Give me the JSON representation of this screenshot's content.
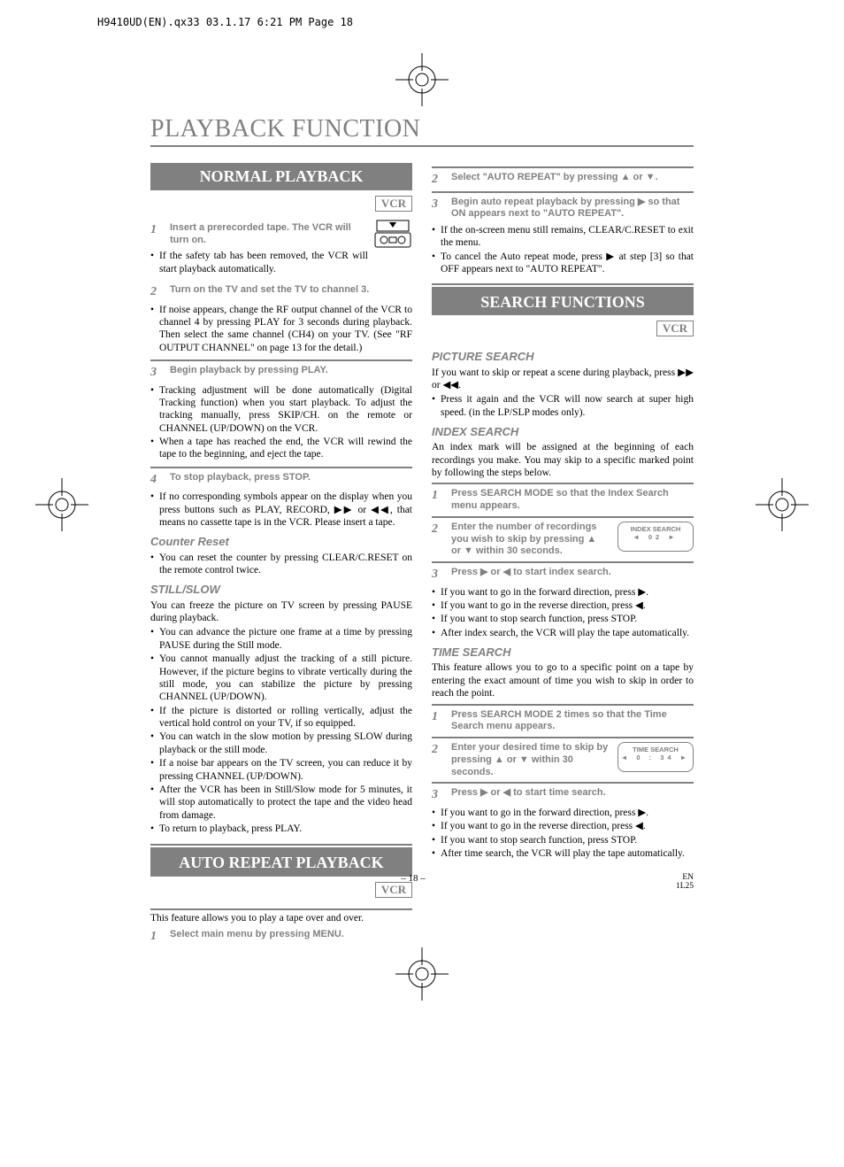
{
  "slug": "H9410UD(EN).qx33   03.1.17  6:21 PM   Page 18",
  "page_title": "PLAYBACK FUNCTION",
  "vcr_label": "VCR",
  "page_num": "– 18 –",
  "footer_en": "EN",
  "footer_code": "1L25",
  "normal": {
    "title": "NORMAL PLAYBACK",
    "step1": "Insert a prerecorded tape. The VCR will turn on.",
    "b1": "If the safety tab has been removed, the VCR will start playback automatically.",
    "step2": "Turn on the TV and set the TV to channel 3.",
    "b2": "If noise appears, change the RF output channel of the VCR to channel 4 by pressing PLAY for 3 seconds during playback.  Then select the same channel (CH4)  on  your  TV.  (See \"RF  OUTPUT CHANNEL\" on page 13 for the detail.)",
    "step3": "Begin playback by pressing PLAY.",
    "b3a": "Tracking adjustment will be done automatically (Digital Tracking function) when you start playback. To adjust the tracking manually, press SKIP/CH. on the remote or CHANNEL (UP/DOWN) on the VCR.",
    "b3b": "When a tape has reached the end, the VCR will rewind the tape to the beginning, and eject the tape.",
    "step4": "To stop playback, press STOP.",
    "b4": "If no corresponding symbols appear on the display when you press buttons such as PLAY, RECORD, ▶▶ or ◀◀, that means no cassette tape is in the VCR. Please insert a tape.",
    "counter_head": "Counter Reset",
    "counter_b": "You can reset the counter by pressing CLEAR/C.RESET on the remote control twice.",
    "still_head": "STILL/SLOW",
    "still_para": "You can freeze the picture on TV screen by pressing PAUSE during playback.",
    "still_b1": "You can advance the picture one frame at a time by pressing PAUSE during the Still mode.",
    "still_b2": "You cannot manually adjust the tracking of a still picture. However, if the picture begins to vibrate vertically during the still mode, you can stabilize the picture by pressing CHANNEL (UP/DOWN).",
    "still_b3": "If the picture is distorted or rolling vertically, adjust the vertical hold control on your TV, if so equipped.",
    "still_b4": "You can watch in the slow motion by pressing SLOW during playback or the still mode.",
    "still_b5": "If a noise bar appears on the TV screen, you can reduce it by pressing CHANNEL (UP/DOWN).",
    "still_b6": "After the VCR has been in Still/Slow mode for 5 minutes, it will stop automatically to protect the tape and the video head from damage.",
    "still_b7": "To return to playback, press PLAY."
  },
  "auto": {
    "title": "AUTO REPEAT PLAYBACK",
    "para": "This feature allows you to play a tape over and over.",
    "step1": "Select main menu by pressing MENU.",
    "step2": "Select \"AUTO REPEAT\" by pressing ▲ or ▼.",
    "step3": "Begin auto repeat playback by pressing ▶ so that ON appears next to \"AUTO REPEAT\".",
    "b1": "If    the    on-screen    menu    still    remains, CLEAR/C.RESET to exit the menu.",
    "b2": "To cancel the Auto repeat mode, press ▶ at step [3] so that OFF appears next to \"AUTO REPEAT\"."
  },
  "search": {
    "title": "SEARCH FUNCTIONS",
    "pic_head": "PICTURE SEARCH",
    "pic_para": "If you want to skip or repeat a scene during playback, press ▶▶ or ◀◀.",
    "pic_b": "Press it again and the VCR will now search at super high speed. (in the LP/SLP modes only).",
    "idx_head": "INDEX SEARCH",
    "idx_para": "An index mark will be assigned at the beginning of each recordings you make. You may skip to a specific marked point by following the steps below.",
    "idx_s1": "Press SEARCH MODE so that the Index Search menu appears.",
    "idx_s2": "Enter the number of recordings you wish to skip by pressing ▲ or ▼ within 30 seconds.",
    "idx_osd_title": "INDEX SEARCH",
    "idx_osd_val": "02",
    "idx_s3": "Press ▶ or ◀ to start index search.",
    "idx_b1": "If you want to go in the forward direction, press ▶.",
    "idx_b2": "If you want to go in the reverse direction, press ◀.",
    "idx_b3": "If you want to stop search function, press STOP.",
    "idx_b4": "After index search, the VCR will play the tape automatically.",
    "ts_head": "TIME SEARCH",
    "ts_para": "This feature allows you to go to a specific point on a tape by entering the exact amount of time you wish to skip in order to reach the point.",
    "ts_s1": "Press SEARCH MODE 2 times so that the Time Search menu appears.",
    "ts_s2": "Enter your desired time to skip by pressing ▲ or ▼ within 30 seconds.",
    "ts_osd_title": "TIME SEARCH",
    "ts_osd_val": "0 : 34",
    "ts_s3": "Press ▶ or ◀ to start time search.",
    "ts_b1": "If you want to go in the forward direction, press ▶.",
    "ts_b2": "If you want to go in the reverse direction, press ◀.",
    "ts_b3": "If you want to stop search function, press STOP.",
    "ts_b4": "After time search, the VCR will play the tape automatically."
  }
}
